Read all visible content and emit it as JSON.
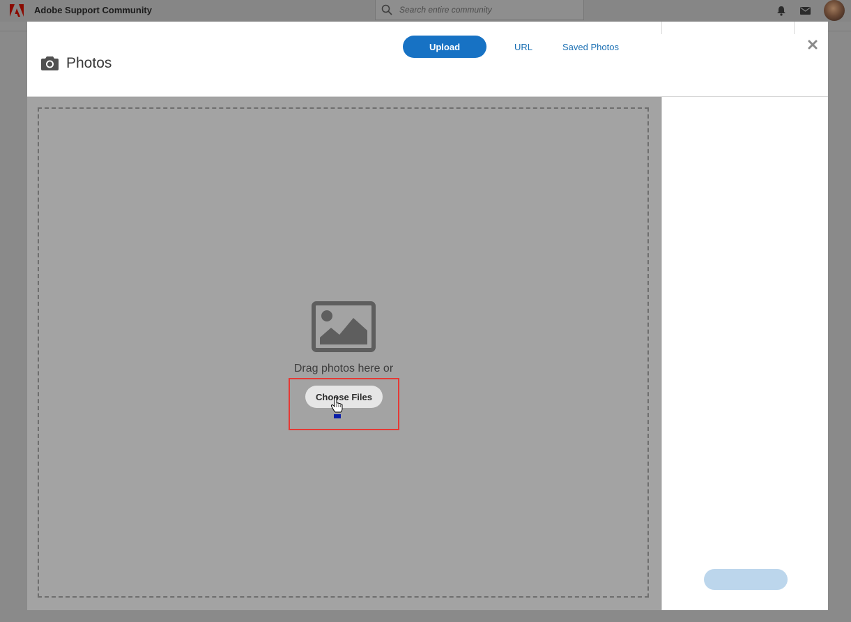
{
  "site": {
    "title": "Adobe Support Community",
    "search_placeholder": "Search entire community"
  },
  "modal": {
    "title": "Photos",
    "tabs": [
      {
        "label": "Upload",
        "active": true
      },
      {
        "label": "URL",
        "active": false
      },
      {
        "label": "Saved Photos",
        "active": false
      }
    ],
    "drop_text": "Drag photos here or",
    "choose_files_label": "Choose Files"
  },
  "icons": {
    "logo": "adobe-logo-icon",
    "search": "search-icon",
    "bell": "bell-icon",
    "mail": "mail-icon",
    "camera": "camera-icon",
    "close": "close-icon",
    "image": "image-placeholder-icon",
    "cursor": "hand-cursor-icon"
  },
  "colors": {
    "brand_red": "#eb1000",
    "primary_blue": "#1772c4",
    "link_blue": "#1a6fb3",
    "highlight_red": "#e53935",
    "disabled_button": "#bcd6ec"
  }
}
